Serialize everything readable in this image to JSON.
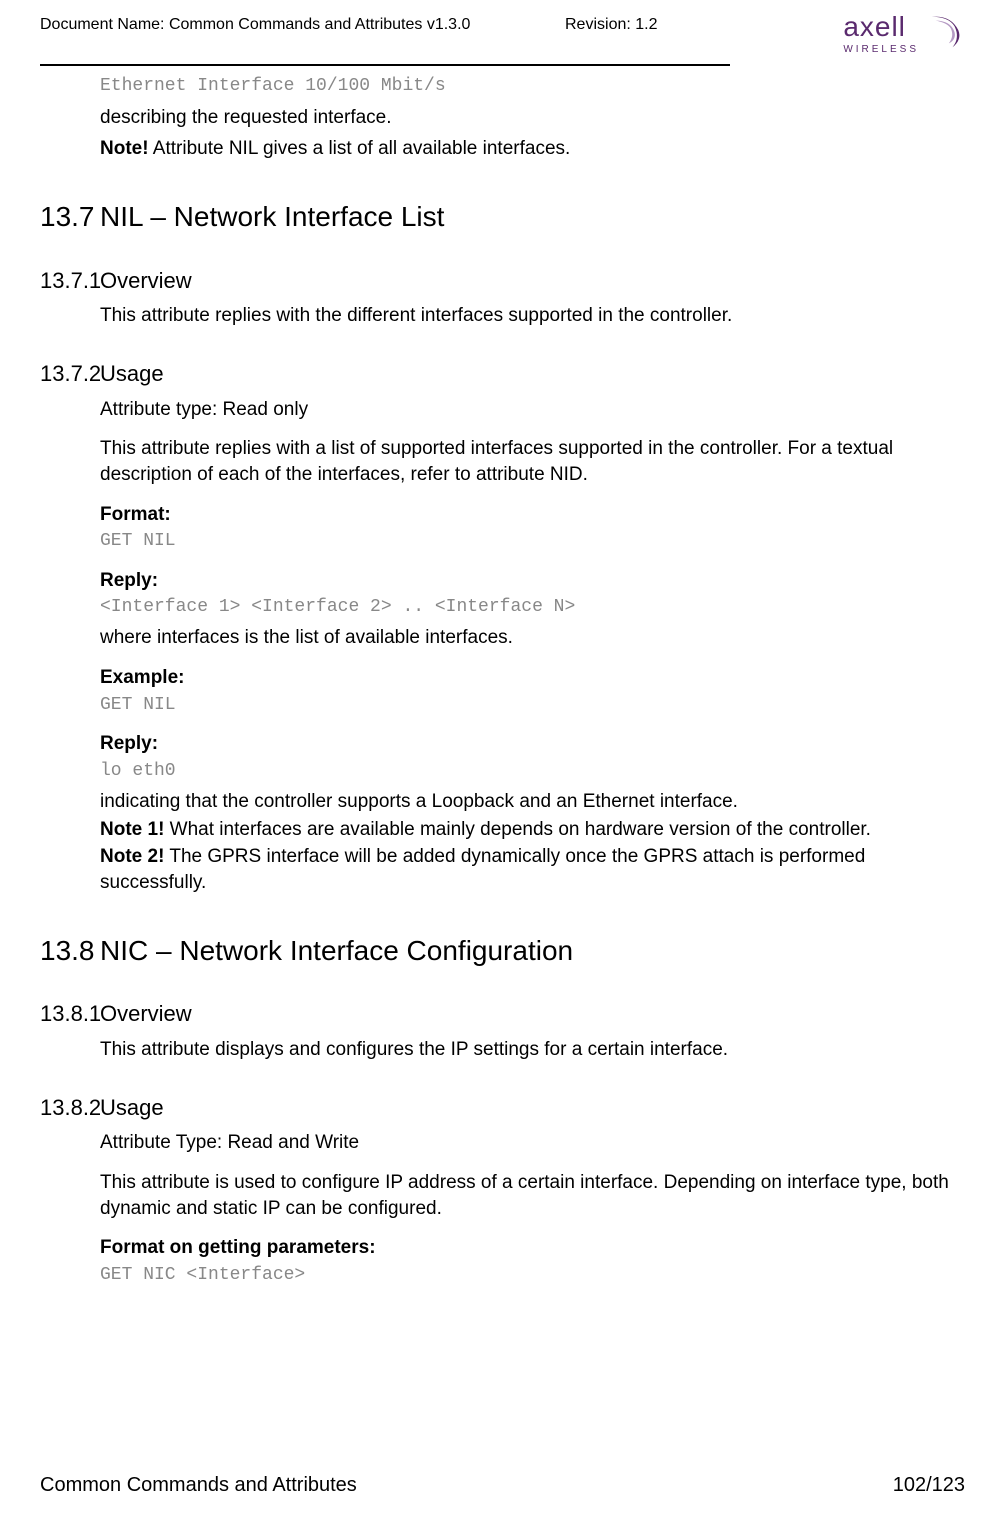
{
  "header": {
    "doc_name": "Document Name: Common Commands and Attributes v1.3.0",
    "revision": "Revision: 1.2",
    "logo_text": "axell",
    "logo_sub": "WIRELESS"
  },
  "intro": {
    "eth_line": "Ethernet Interface 10/100 Mbit/s",
    "describing": "describing the requested interface.",
    "note_bold": "Note!",
    "note_rest": " Attribute NIL gives a list of all available interfaces."
  },
  "s137": {
    "num": "13.7",
    "title": "NIL – Network Interface List",
    "s1_num": "13.7.1",
    "s1_title": "Overview",
    "s1_p1": "This attribute replies with the different interfaces supported in the controller.",
    "s2_num": "13.7.2",
    "s2_title": "Usage",
    "s2_p1": "Attribute type: Read only",
    "s2_p2": "This attribute replies with a list of supported interfaces supported in the controller. For a textual description of each of the interfaces, refer to attribute NID.",
    "format_label": "Format:",
    "format_code": "GET NIL",
    "reply_label": "Reply:",
    "reply_code": "<Interface 1> <Interface 2> .. <Interface N>",
    "reply_desc": "where interfaces is the list of available interfaces.",
    "example_label": "Example:",
    "example_code": "GET NIL",
    "reply2_label": "Reply:",
    "reply2_code": "lo eth0",
    "reply2_desc": "indicating that the controller supports a Loopback and an Ethernet interface.",
    "note1_bold": "Note 1!",
    "note1_rest": " What interfaces are available mainly depends on hardware version of the controller.",
    "note2_bold": "Note 2!",
    "note2_rest": " The GPRS interface will be added dynamically once the GPRS attach is performed successfully."
  },
  "s138": {
    "num": "13.8",
    "title": "NIC – Network Interface Configuration",
    "s1_num": "13.8.1",
    "s1_title": "Overview",
    "s1_p1": "This attribute displays and configures the IP settings for a certain interface.",
    "s2_num": "13.8.2",
    "s2_title": "Usage",
    "s2_p1": "Attribute Type: Read and Write",
    "s2_p2": "This attribute is used to configure IP address of a certain interface. Depending on interface type, both dynamic and static IP can be configured.",
    "format_label": "Format on getting parameters:",
    "format_code": "GET NIC <Interface>"
  },
  "footer": {
    "left": "Common Commands and Attributes",
    "right": "102/123"
  }
}
